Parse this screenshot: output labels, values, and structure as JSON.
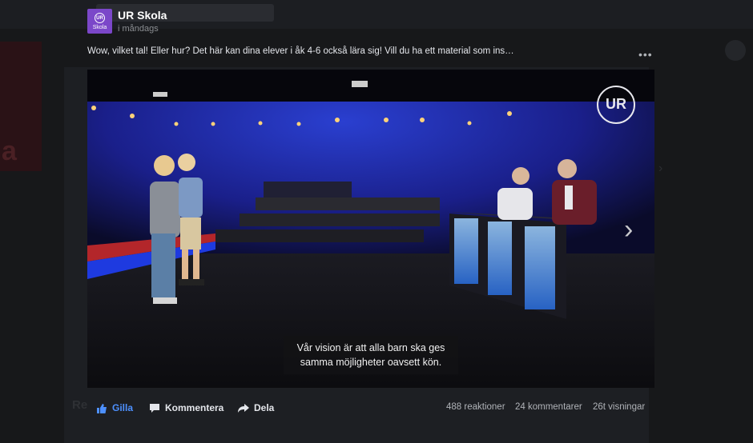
{
  "post": {
    "page_name": "UR Skola",
    "timestamp": "i måndags",
    "caption": "Wow, vilket tal! Eller hur? Det här kan dina elever i åk 4-6 också lära sig! Vill du ha ett material som ins…",
    "logo": {
      "mark": "UR",
      "label": "Skola",
      "color": "#7b47c9"
    }
  },
  "video": {
    "watermark": "UR",
    "subtitle_line1": "Vår vision är att alla barn ska ges",
    "subtitle_line2": "samma möjligheter oavsett kön.",
    "next_icon": "chevron-right-icon"
  },
  "actions": {
    "like": "Gilla",
    "comment": "Kommentera",
    "share": "Dela"
  },
  "stats": {
    "reactions": "488 reaktioner",
    "comments": "24 kommentarer",
    "views": "26t visningar"
  },
  "colors": {
    "like_blue": "#4d90fe",
    "backdrop": "#17181a"
  }
}
